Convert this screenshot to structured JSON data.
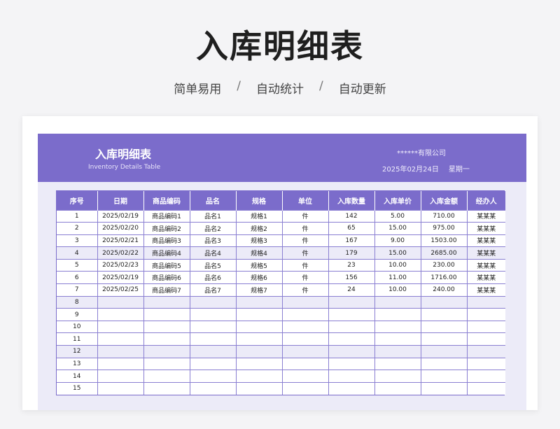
{
  "page": {
    "title": "入库明细表",
    "tags": [
      "简单易用",
      "自动统计",
      "自动更新"
    ],
    "tag_separator": "/"
  },
  "banner": {
    "title": "入库明细表",
    "subtitle_en": "Inventory Details Table",
    "company": "******有限公司",
    "date": "2025年02月24日",
    "weekday": "星期一"
  },
  "colors": {
    "accent": "#7b6ccb",
    "panel_bg": "#ecebf8",
    "alt_row": "#ecebf8"
  },
  "table": {
    "headers": [
      "序号",
      "日期",
      "商品编码",
      "品名",
      "规格",
      "单位",
      "入库数量",
      "入库单价",
      "入库金额",
      "经办人"
    ],
    "rows": [
      [
        "1",
        "2025/02/19",
        "商品编码1",
        "品名1",
        "规格1",
        "件",
        "142",
        "5.00",
        "710.00",
        "某某某"
      ],
      [
        "2",
        "2025/02/20",
        "商品编码2",
        "品名2",
        "规格2",
        "件",
        "65",
        "15.00",
        "975.00",
        "某某某"
      ],
      [
        "3",
        "2025/02/21",
        "商品编码3",
        "品名3",
        "规格3",
        "件",
        "167",
        "9.00",
        "1503.00",
        "某某某"
      ],
      [
        "4",
        "2025/02/22",
        "商品编码4",
        "品名4",
        "规格4",
        "件",
        "179",
        "15.00",
        "2685.00",
        "某某某"
      ],
      [
        "5",
        "2025/02/23",
        "商品编码5",
        "品名5",
        "规格5",
        "件",
        "23",
        "10.00",
        "230.00",
        "某某某"
      ],
      [
        "6",
        "2025/02/19",
        "商品编码6",
        "品名6",
        "规格6",
        "件",
        "156",
        "11.00",
        "1716.00",
        "某某某"
      ],
      [
        "7",
        "2025/02/25",
        "商品编码7",
        "品名7",
        "规格7",
        "件",
        "24",
        "10.00",
        "240.00",
        "某某某"
      ],
      [
        "8",
        "",
        "",
        "",
        "",
        "",
        "",
        "",
        "",
        ""
      ],
      [
        "9",
        "",
        "",
        "",
        "",
        "",
        "",
        "",
        "",
        ""
      ],
      [
        "10",
        "",
        "",
        "",
        "",
        "",
        "",
        "",
        "",
        ""
      ],
      [
        "11",
        "",
        "",
        "",
        "",
        "",
        "",
        "",
        "",
        ""
      ],
      [
        "12",
        "",
        "",
        "",
        "",
        "",
        "",
        "",
        "",
        ""
      ],
      [
        "13",
        "",
        "",
        "",
        "",
        "",
        "",
        "",
        "",
        ""
      ],
      [
        "14",
        "",
        "",
        "",
        "",
        "",
        "",
        "",
        "",
        ""
      ],
      [
        "15",
        "",
        "",
        "",
        "",
        "",
        "",
        "",
        "",
        ""
      ]
    ]
  }
}
